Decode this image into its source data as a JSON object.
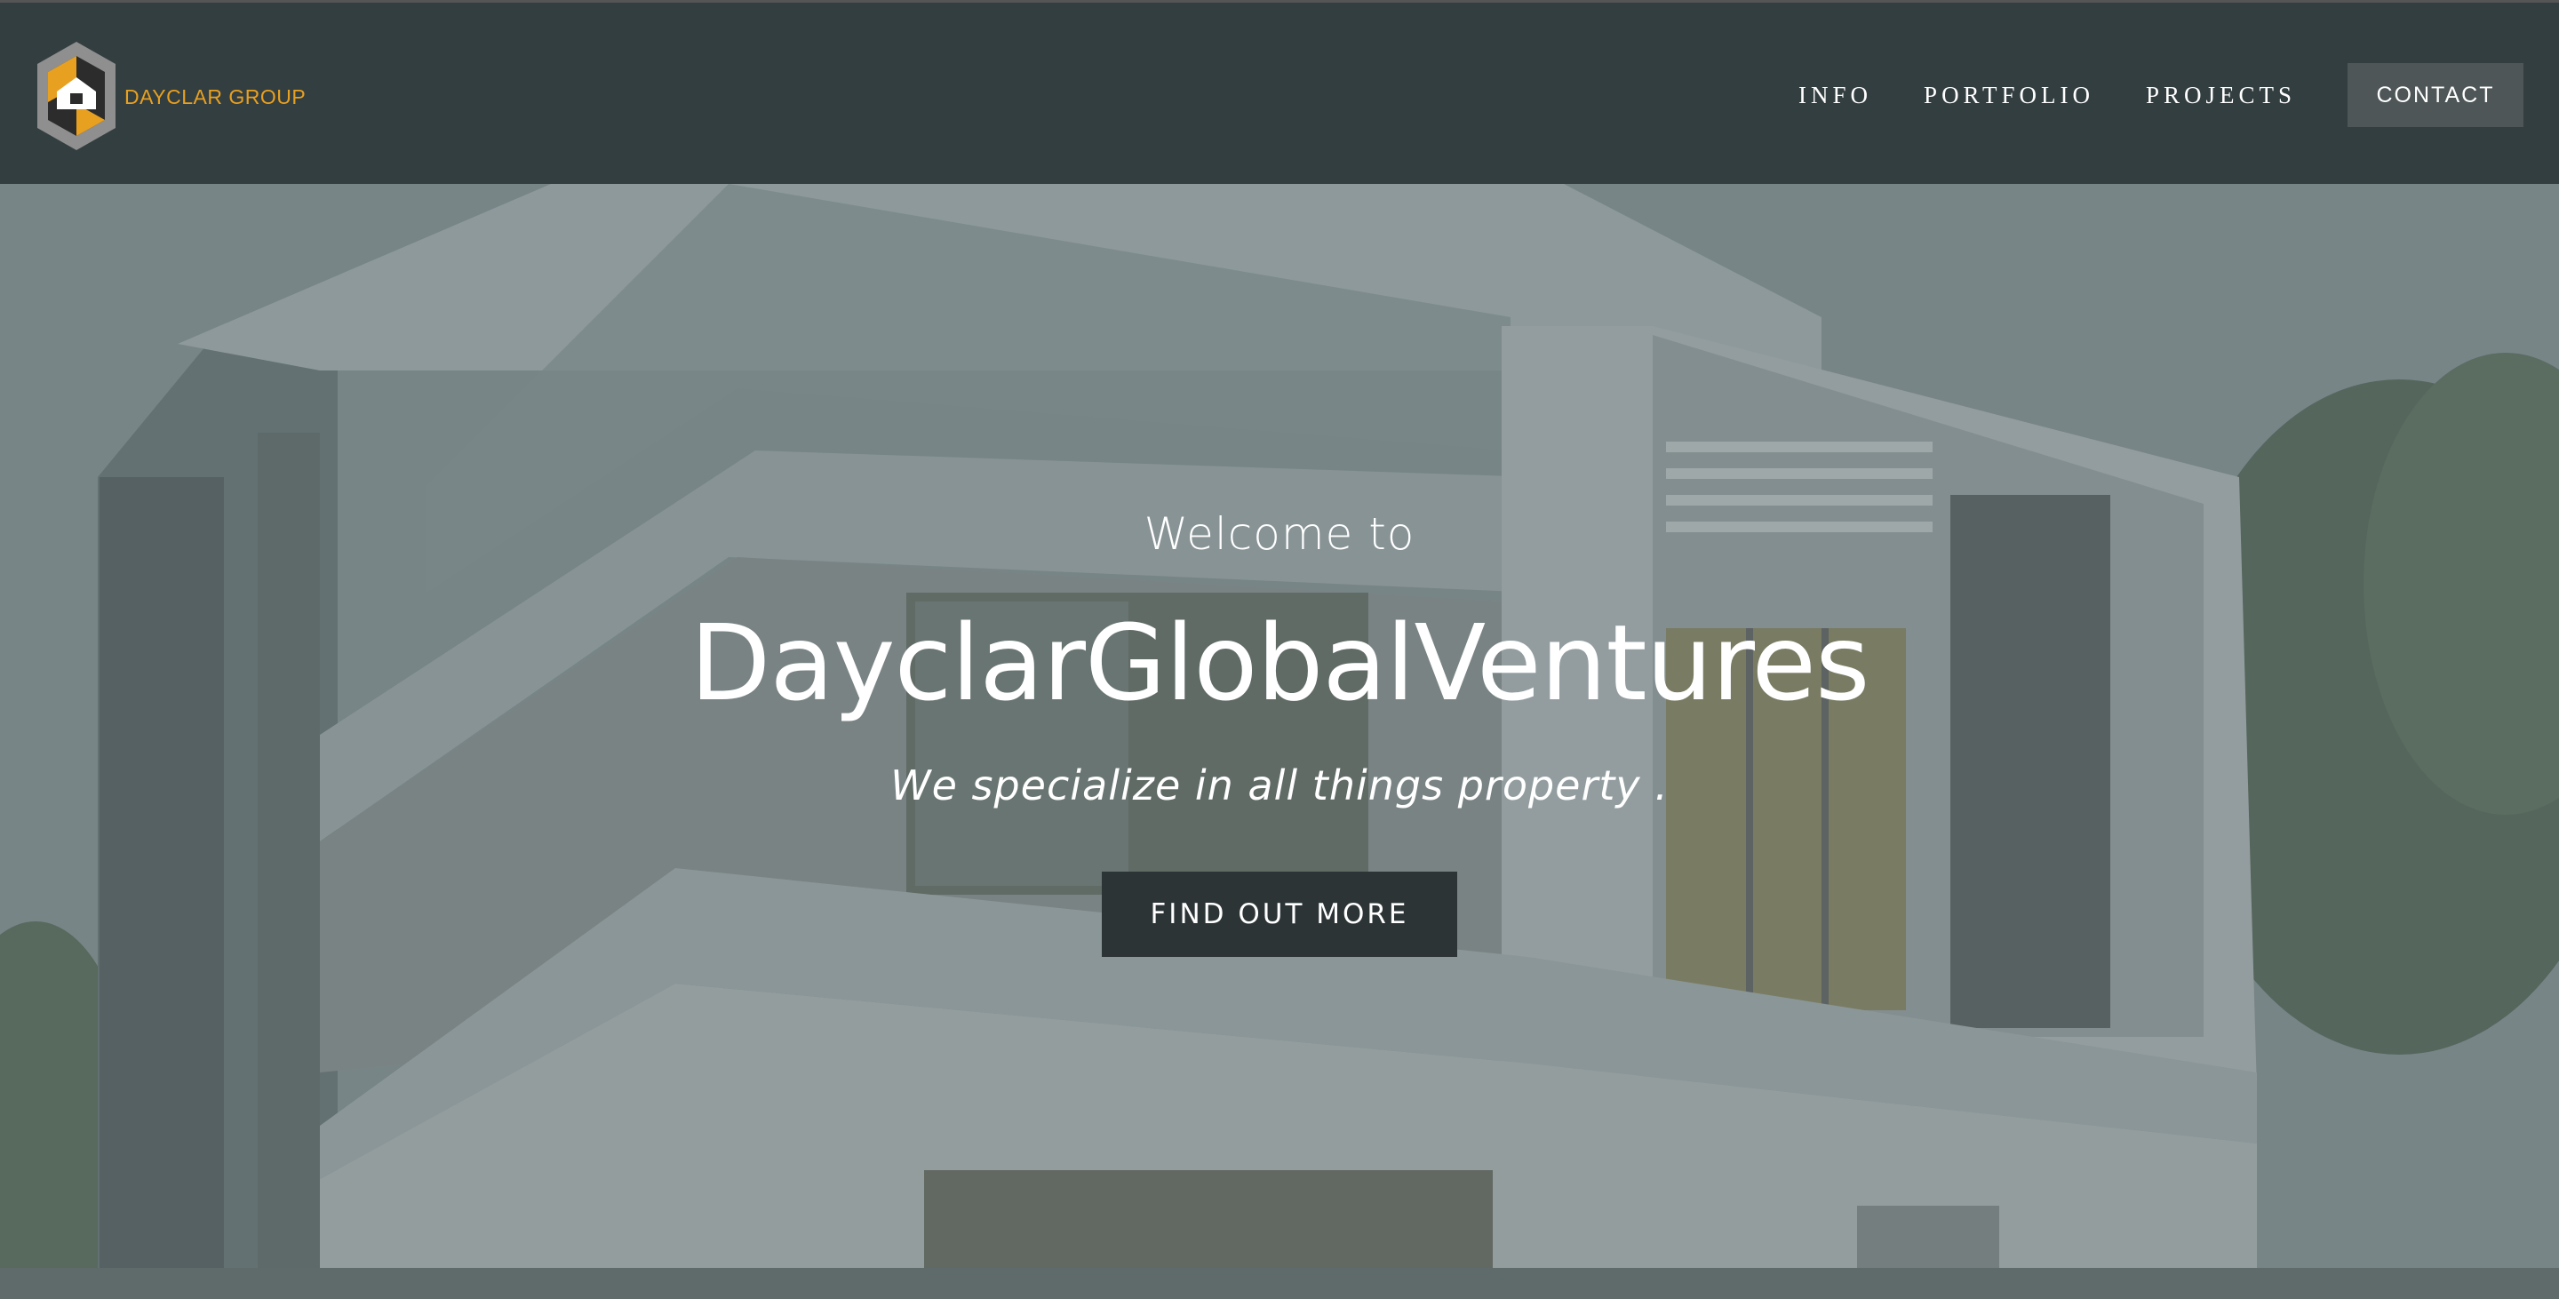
{
  "header": {
    "logo_text": "DAYCLAR GROUP",
    "nav": {
      "info": "INFO",
      "portfolio": "PORTFOLIO",
      "projects": "PROJECTS",
      "contact": "CONTACT"
    }
  },
  "hero": {
    "kicker": "Welcome to",
    "title": "DayclarGlobalVentures",
    "tagline": "We specialize in all things property .",
    "cta_label": "FIND OUT MORE"
  },
  "colors": {
    "header_bg": "#333e40",
    "logo_accent": "#e8a020",
    "contact_button_bg": "#4e5657",
    "cta_bg": "#2c3436"
  },
  "icons": {
    "logo": "house-hexagon-logo"
  }
}
